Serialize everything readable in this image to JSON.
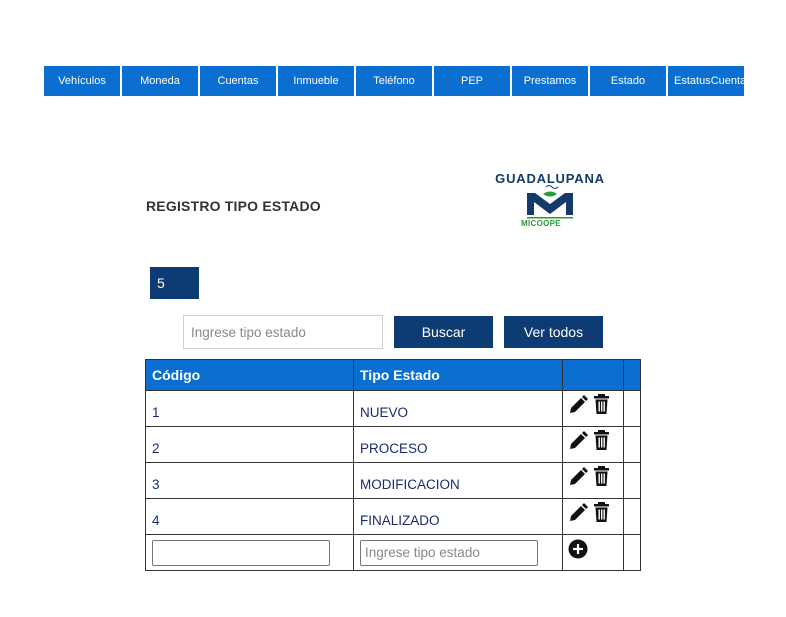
{
  "nav": {
    "items": [
      {
        "label": "Vehículos"
      },
      {
        "label": "Moneda"
      },
      {
        "label": "Cuentas"
      },
      {
        "label": "Inmueble"
      },
      {
        "label": "Teléfono"
      },
      {
        "label": "PEP"
      },
      {
        "label": "Prestamos"
      },
      {
        "label": "Estado"
      },
      {
        "label": "Estatus Cuentas",
        "line1": "Estatus",
        "line2": "Cuentas"
      }
    ]
  },
  "page": {
    "title": "REGISTRO TIPO ESTADO",
    "count": "5"
  },
  "logo": {
    "word": "GUADALUPANA",
    "sub": "MICOOPE",
    "primary_color": "#133a6a",
    "accent_color": "#2a9a3c"
  },
  "search": {
    "placeholder": "Ingrese tipo estado",
    "search_label": "Buscar",
    "view_all_label": "Ver todos"
  },
  "table": {
    "headers": {
      "code": "Código",
      "type": "Tipo Estado"
    },
    "rows": [
      {
        "code": "1",
        "type": "NUEVO"
      },
      {
        "code": "2",
        "type": "PROCESO"
      },
      {
        "code": "3",
        "type": "MODIFICACION"
      },
      {
        "code": "4",
        "type": "FINALIZADO"
      }
    ],
    "new_row": {
      "code_value": "",
      "type_placeholder": "Ingrese tipo estado"
    },
    "row_icons": [
      "pencil-icon",
      "trash-icon"
    ],
    "add_icon": "plus-circle-icon"
  },
  "colors": {
    "nav_bg": "#0a6fd1",
    "header_bg": "#0a6fd1",
    "button_bg": "#0d3b73"
  }
}
